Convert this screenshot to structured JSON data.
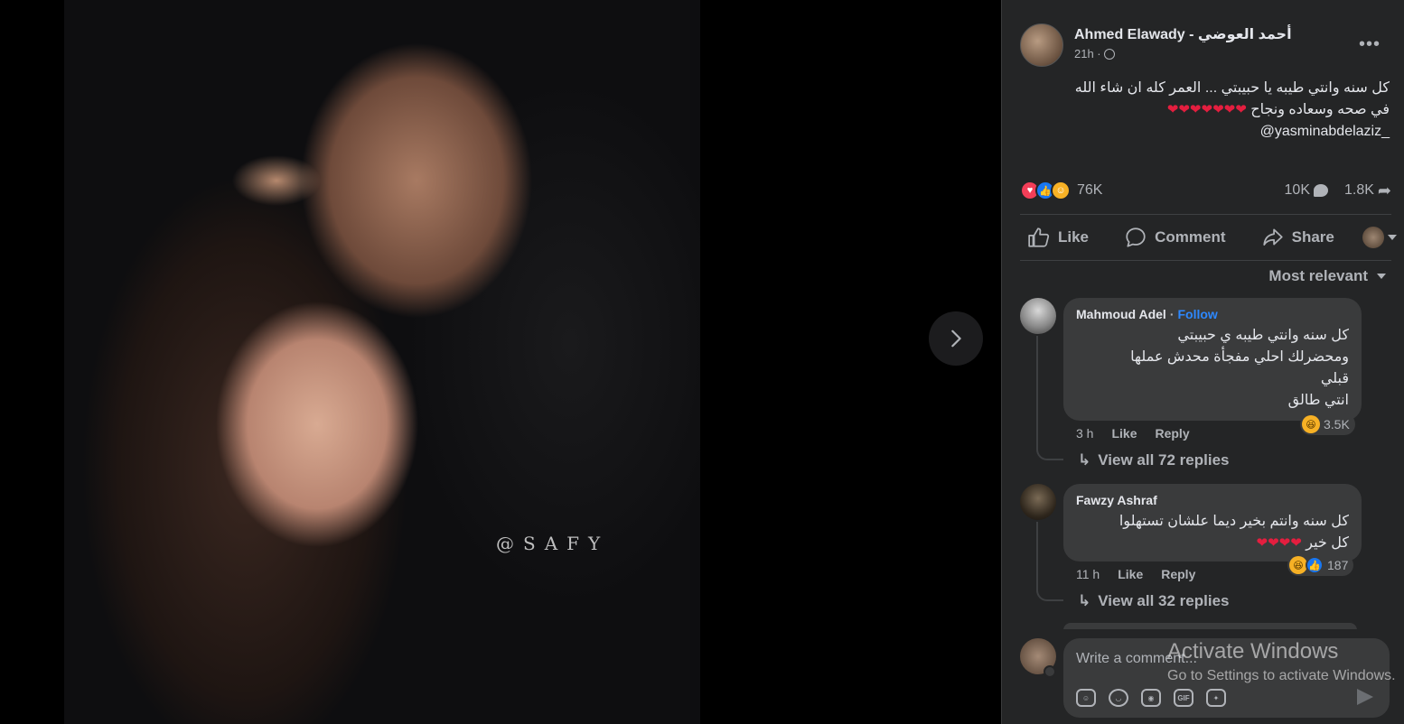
{
  "viewer": {
    "watermark": "@SAFY"
  },
  "post": {
    "author": "Ahmed Elawady - أحمد العوضي",
    "time": "21h ·",
    "text_line1": "كل سنه وانتي طيبه يا حبيبتي ... العمر كله ان شاء الله",
    "text_line2": "في صحه وسعاده ونجاح",
    "hearts": "❤❤❤❤❤❤❤",
    "mention": "@yasminabdelaziz_",
    "reaction_count": "76K",
    "comment_count": "10K",
    "share_count": "1.8K"
  },
  "actions": {
    "like": "Like",
    "comment": "Comment",
    "share": "Share"
  },
  "sort_label": "Most relevant",
  "comments": [
    {
      "name": "Mahmoud Adel",
      "follow": "Follow",
      "lines": [
        "كل سنه وانتي طيبه ي حبيبتي",
        "ومحضرلك احلي مفجأة محدش عملها",
        "قبلي",
        "انتي طالق"
      ],
      "time": "3 h",
      "like": "Like",
      "reply": "Reply",
      "reactions": "3.5K",
      "view_replies": "View all 72 replies"
    },
    {
      "name": "Fawzy Ashraf",
      "lines": [
        "كل سنه وانتم بخير ديما علشان تستهلوا",
        "كل خير"
      ],
      "hearts": "❤❤❤❤",
      "time": "11 h",
      "like": "Like",
      "reply": "Reply",
      "reactions": "187",
      "view_replies": "View all 32 replies"
    }
  ],
  "composer": {
    "placeholder": "Write a comment..."
  },
  "os_overlay": {
    "title": "Activate Windows",
    "subtitle": "Go to Settings to activate Windows."
  },
  "colors": {
    "panel_bg": "#242526",
    "bubble_bg": "#3a3b3c",
    "accent": "#2d88ff",
    "heart": "#e41e3f"
  }
}
